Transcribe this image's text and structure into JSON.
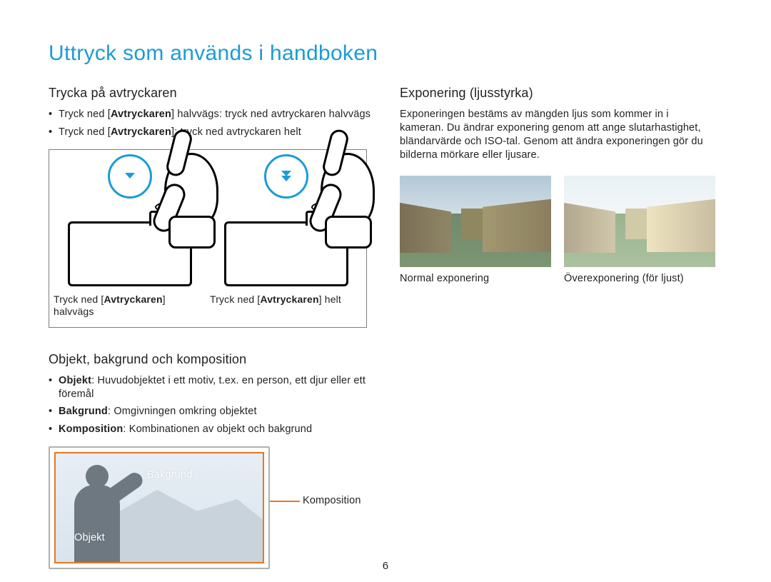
{
  "page_title": "Uttryck som används i handboken",
  "page_number": "6",
  "left": {
    "section1_heading": "Trycka på avtryckaren",
    "bullets1": {
      "b1_pre": "Tryck ned [",
      "b1_bold": "Avtryckaren",
      "b1_post": "] halvvägs: tryck ned avtryckaren halvvägs",
      "b2_pre": "Tryck ned [",
      "b2_bold": "Avtryckaren",
      "b2_post": "]: tryck ned avtryckaren helt"
    },
    "fig1": {
      "cap_half_pre": "Tryck ned [",
      "cap_half_bold": "Avtryckaren",
      "cap_half_post": "] halvvägs",
      "cap_full_pre": "Tryck ned [",
      "cap_full_bold": "Avtryckaren",
      "cap_full_post": "] helt"
    },
    "section2_heading": "Objekt, bakgrund och komposition",
    "bullets2": {
      "b1_bold": "Objekt",
      "b1_rest": ": Huvudobjektet i ett motiv, t.ex. en person, ett djur eller ett föremål",
      "b2_bold": "Bakgrund",
      "b2_rest": ": Omgivningen omkring objektet",
      "b3_bold": "Komposition",
      "b3_rest": ": Kombinationen av objekt och bakgrund"
    },
    "comp_labels": {
      "bakgrund": "Bakgrund",
      "objekt": "Objekt",
      "komposition": "Komposition"
    }
  },
  "right": {
    "section1_heading": "Exponering (ljusstyrka)",
    "para": "Exponeringen bestäms av mängden ljus som kommer in i kameran. Du ändrar exponering genom att ange slutarhastighet, bländarvärde och ISO-tal. Genom att ändra exponeringen gör du bilderna mörkare eller ljusare.",
    "cap_normal": "Normal exponering",
    "cap_over": "Överexponering (för ljust)"
  }
}
